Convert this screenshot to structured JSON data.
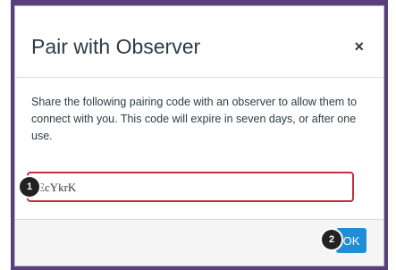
{
  "dialog": {
    "title": "Pair with Observer",
    "close_label": "×",
    "description": "Share the following pairing code with an observer to allow them to connect with you. This code will expire in seven days, or after one use.",
    "pairing_code": "EcYkrK",
    "ok_label": "OK"
  },
  "annotations": {
    "step_1": "1",
    "step_2": "2"
  },
  "colors": {
    "frame": "#5a3f7e",
    "highlight_border": "#c2303a",
    "ok_button": "#1f8ed6",
    "badge": "#222222"
  },
  "icons": {
    "close": "close-icon"
  }
}
